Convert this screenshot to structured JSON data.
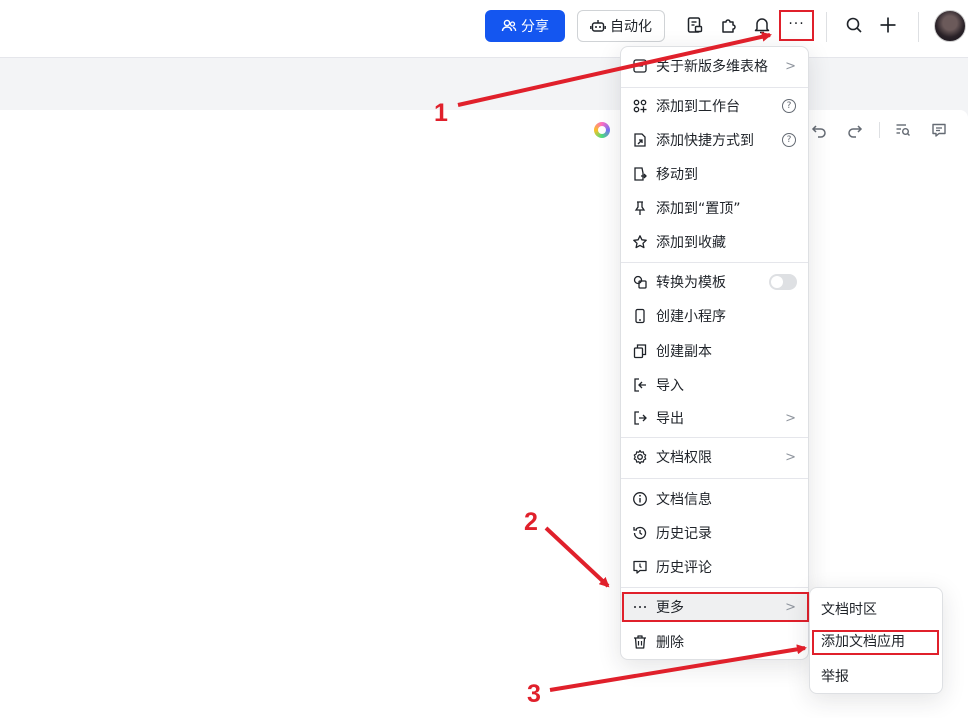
{
  "toolbar": {
    "share_label": "分享",
    "automation_label": "自动化",
    "more_label": "···",
    "icons": [
      "doc-template-icon",
      "plugin-icon",
      "bell-icon",
      "more-icon",
      "search-icon",
      "plus-icon",
      "avatar"
    ]
  },
  "editor_icons": [
    "ai-assistant-icon",
    "undo-icon",
    "redo-icon",
    "find-icon",
    "comment-icon"
  ],
  "menu": {
    "items": [
      {
        "label": "关于新版多维表格",
        "icon": "info-square-icon",
        "has_submenu": true
      },
      {
        "label": "添加到工作台",
        "icon": "apps-icon",
        "has_help": true
      },
      {
        "label": "添加快捷方式到",
        "icon": "shortcut-icon",
        "has_help": true
      },
      {
        "label": "移动到",
        "icon": "move-icon"
      },
      {
        "label": "添加到“置顶”",
        "icon": "pin-icon"
      },
      {
        "label": "添加到收藏",
        "icon": "star-icon"
      },
      {
        "label": "转换为模板",
        "icon": "template-icon",
        "toggle": false
      },
      {
        "label": "创建小程序",
        "icon": "phone-icon"
      },
      {
        "label": "创建副本",
        "icon": "copy-icon"
      },
      {
        "label": "导入",
        "icon": "import-icon"
      },
      {
        "label": "导出",
        "icon": "export-icon",
        "has_submenu": true
      },
      {
        "label": "文档权限",
        "icon": "settings-icon",
        "has_submenu": true
      },
      {
        "label": "文档信息",
        "icon": "info-icon"
      },
      {
        "label": "历史记录",
        "icon": "history-icon"
      },
      {
        "label": "历史评论",
        "icon": "comment-history-icon"
      },
      {
        "label": "更多",
        "icon": "more-icon",
        "has_submenu": true,
        "highlighted": true
      },
      {
        "label": "删除",
        "icon": "trash-icon"
      }
    ],
    "chevron": ">",
    "help": "?"
  },
  "submenu": {
    "items": [
      {
        "label": "文档时区"
      },
      {
        "label": "添加文档应用",
        "highlighted": true
      },
      {
        "label": "举报"
      }
    ]
  },
  "annotations": {
    "steps": [
      "1",
      "2",
      "3"
    ],
    "color": "#e0202b"
  },
  "colors": {
    "primary": "#1456f0",
    "annotation": "#e0202b"
  }
}
